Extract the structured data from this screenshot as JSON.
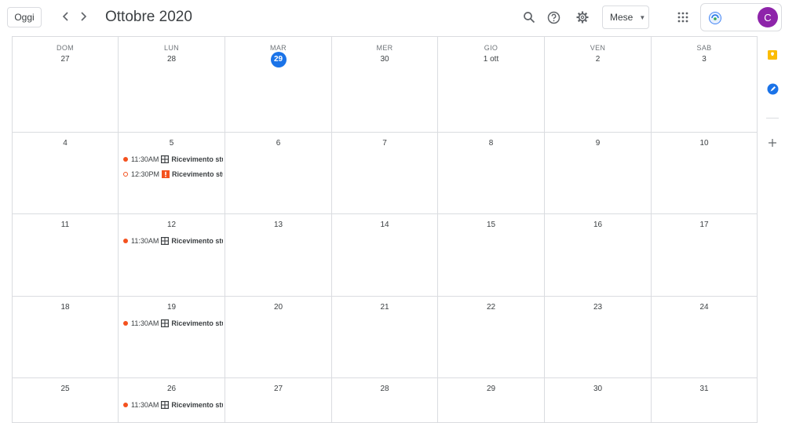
{
  "header": {
    "today_label": "Oggi",
    "prev_icon": "‹",
    "next_icon": "›",
    "title": "Ottobre 2020",
    "view_label": "Mese",
    "avatar_letter": "C",
    "avatar_color": "#8e24aa",
    "icons": [
      "search-icon",
      "help-icon",
      "settings-icon",
      "apps-grid-icon",
      "org-logo-icon"
    ]
  },
  "calendar": {
    "weekdays": [
      "DOM",
      "LUN",
      "MAR",
      "MER",
      "GIO",
      "VEN",
      "SAB"
    ],
    "today_color": "#1a73e8",
    "weeks": [
      [
        "27",
        "28",
        "29",
        "30",
        "1 ott",
        "2",
        "3"
      ],
      [
        "4",
        "5",
        "6",
        "7",
        "8",
        "9",
        "10"
      ],
      [
        "11",
        "12",
        "13",
        "14",
        "15",
        "16",
        "17"
      ],
      [
        "18",
        "19",
        "20",
        "21",
        "22",
        "23",
        "24"
      ],
      [
        "25",
        "26",
        "27",
        "28",
        "29",
        "30",
        "31"
      ]
    ],
    "today": {
      "week": 0,
      "day": 2
    },
    "events": [
      {
        "week": 1,
        "day": 1,
        "slot": 0,
        "time": "11:30AM",
        "title": "Ricevimento studenti",
        "dot": "filled",
        "icon": "table-icon"
      },
      {
        "week": 1,
        "day": 1,
        "slot": 1,
        "time": "12:30PM",
        "title": "Ricevimento studenti",
        "dot": "hollow",
        "icon": "warning-icon"
      },
      {
        "week": 2,
        "day": 1,
        "slot": 0,
        "time": "11:30AM",
        "title": "Ricevimento studenti",
        "dot": "filled",
        "icon": "table-icon"
      },
      {
        "week": 3,
        "day": 1,
        "slot": 0,
        "time": "11:30AM",
        "title": "Ricevimento studenti",
        "dot": "filled",
        "icon": "table-icon"
      },
      {
        "week": 4,
        "day": 1,
        "slot": 0,
        "time": "11:30AM",
        "title": "Ricevimento studenti",
        "dot": "filled",
        "icon": "table-icon"
      }
    ],
    "event_color": "#f4511e"
  },
  "side_panel": {
    "items": [
      "keep-icon",
      "tasks-icon",
      "add-icon"
    ],
    "keep_color": "#fbbc04",
    "tasks_color": "#1a73e8"
  }
}
